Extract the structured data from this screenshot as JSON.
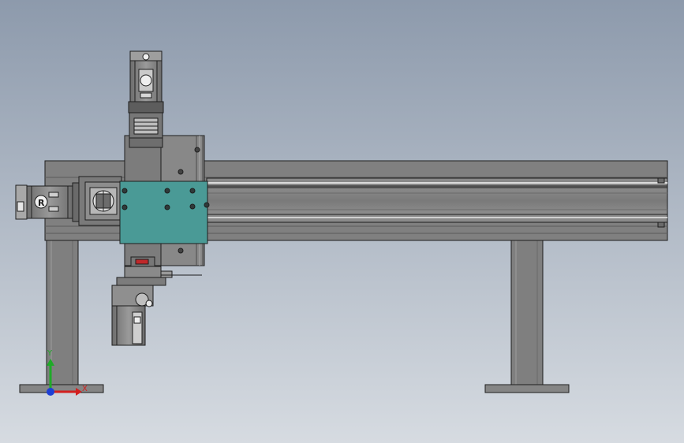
{
  "viewport": {
    "background_top": "#8d9aac",
    "background_bottom": "#d6dbe1"
  },
  "colors": {
    "frame": "#7f7f7f",
    "frame_dark": "#5e5e5e",
    "frame_light": "#a3a3a3",
    "outline": "#1e1e1e",
    "carriage_plate": "#4a9a96",
    "accent_red": "#c0282a",
    "triad_x": "#d21f1f",
    "triad_y": "#1faa28",
    "triad_z": "#1e3fd6"
  },
  "triad": {
    "x_label": "X",
    "y_label": "Y"
  },
  "model": {
    "components": [
      "gantry-frame",
      "left-leg",
      "right-leg",
      "x-axis-rail",
      "x-axis-servo-motor",
      "z-axis-column",
      "z-axis-servo-motor",
      "carriage-plate",
      "rotary-gripper-head"
    ]
  }
}
